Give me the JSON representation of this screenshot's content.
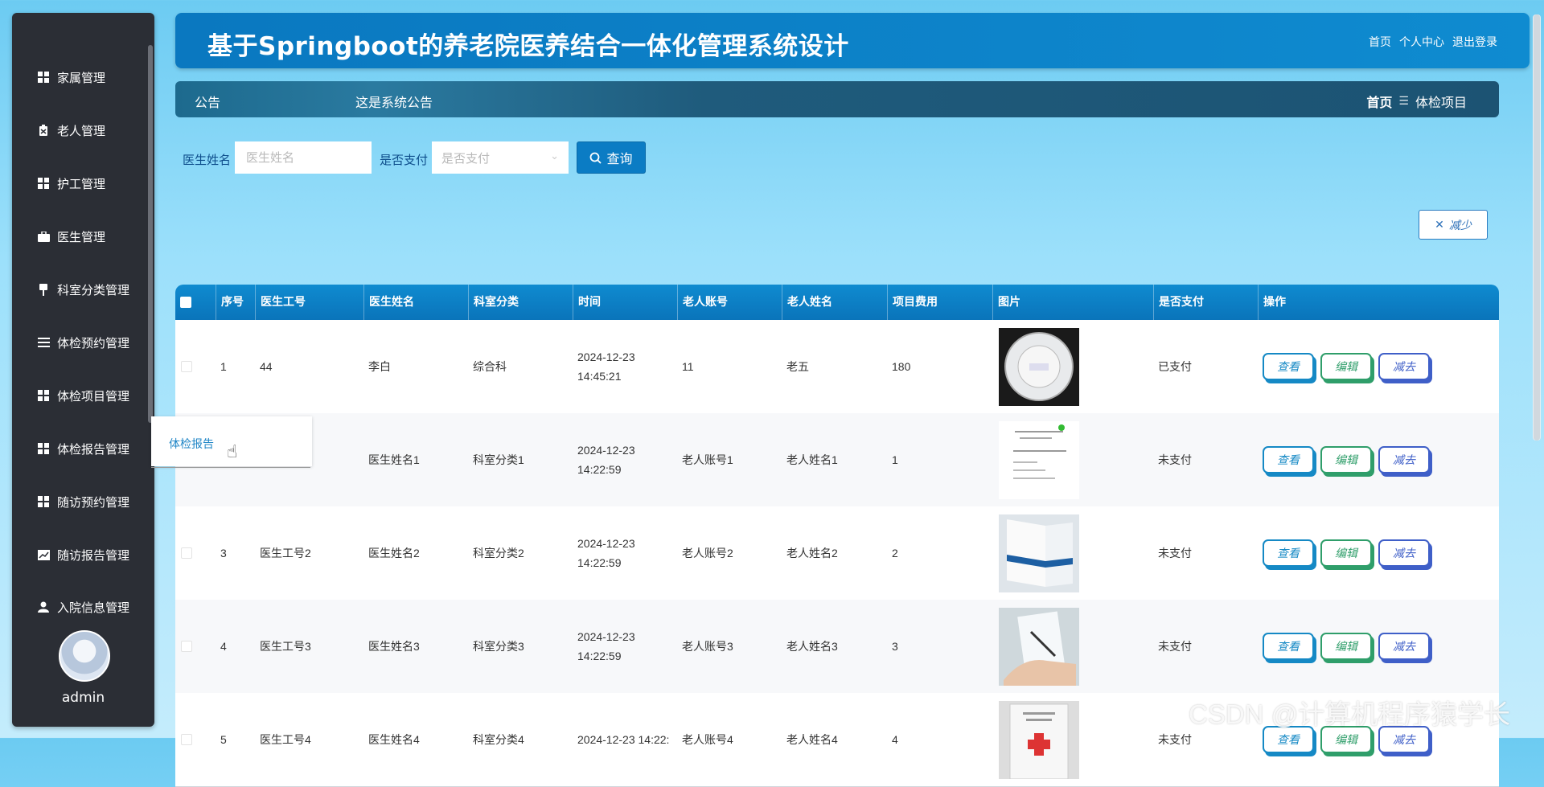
{
  "app": {
    "title": "基于Springboot的养老院医养结合一体化管理系统设计",
    "links": [
      "首页",
      "个人中心",
      "退出登录"
    ]
  },
  "sidebar": {
    "items": [
      {
        "label": "家属管理",
        "icon": "grid-icon"
      },
      {
        "label": "老人管理",
        "icon": "clipboard-icon"
      },
      {
        "label": "护工管理",
        "icon": "grid-icon"
      },
      {
        "label": "医生管理",
        "icon": "briefcase-icon"
      },
      {
        "label": "科室分类管理",
        "icon": "pin-icon"
      },
      {
        "label": "体检预约管理",
        "icon": "list-icon"
      },
      {
        "label": "体检项目管理",
        "icon": "grid-icon"
      },
      {
        "label": "体检报告管理",
        "icon": "grid-icon"
      },
      {
        "label": "随访预约管理",
        "icon": "grid-icon"
      },
      {
        "label": "随访报告管理",
        "icon": "chart-icon"
      },
      {
        "label": "入院信息管理",
        "icon": "user-icon"
      }
    ],
    "user": "admin"
  },
  "notice": {
    "label": "公告",
    "text": "这是系统公告"
  },
  "breadcrumb": {
    "home": "首页",
    "sep": "☰",
    "current": "体检项目"
  },
  "search": {
    "doctor_label": "医生姓名",
    "doctor_placeholder": "医生姓名",
    "paid_label": "是否支付",
    "paid_placeholder": "是否支付",
    "query_button": "查询"
  },
  "reduce_button": "减少",
  "table": {
    "headers": [
      "序号",
      "医生工号",
      "医生姓名",
      "科室分类",
      "时间",
      "老人账号",
      "老人姓名",
      "项目费用",
      "图片",
      "是否支付",
      "操作"
    ],
    "rows": [
      {
        "idx": "1",
        "doc_id": "44",
        "doc_name": "李白",
        "dept": "综合科",
        "time": "2024-12-23 14:45:21",
        "acct": "11",
        "elder": "老五",
        "fee": "180",
        "img": "scale",
        "paid": "已支付"
      },
      {
        "idx": "",
        "doc_id": "",
        "doc_name": "医生姓名1",
        "dept": "科室分类1",
        "time": "2024-12-23 14:22:59",
        "acct": "老人账号1",
        "elder": "老人姓名1",
        "fee": "1",
        "img": "doc",
        "paid": "未支付"
      },
      {
        "idx": "3",
        "doc_id": "医生工号2",
        "doc_name": "医生姓名2",
        "dept": "科室分类2",
        "time": "2024-12-23 14:22:59",
        "acct": "老人账号2",
        "elder": "老人姓名2",
        "fee": "2",
        "img": "brochure",
        "paid": "未支付"
      },
      {
        "idx": "4",
        "doc_id": "医生工号3",
        "doc_name": "医生姓名3",
        "dept": "科室分类3",
        "time": "2024-12-23 14:22:59",
        "acct": "老人账号3",
        "elder": "老人姓名3",
        "fee": "3",
        "img": "hands",
        "paid": "未支付"
      },
      {
        "idx": "5",
        "doc_id": "医生工号4",
        "doc_name": "医生姓名4",
        "dept": "科室分类4",
        "time": "2024-12-23 14:22:",
        "acct": "老人账号4",
        "elder": "老人姓名4",
        "fee": "4",
        "img": "card",
        "paid": "未支付"
      }
    ],
    "actions": {
      "view": "查看",
      "edit": "编辑",
      "del": "减去"
    }
  },
  "popup": {
    "text": "体检报告"
  },
  "watermark": "CSDN @计算机程序猿学长"
}
